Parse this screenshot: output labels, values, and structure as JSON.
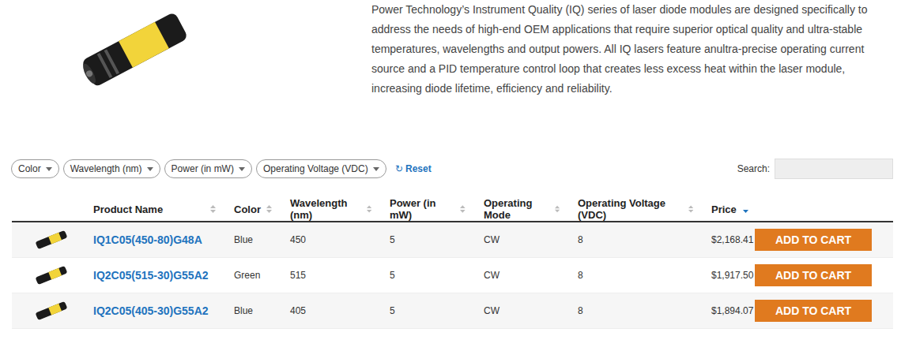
{
  "intro": {
    "description": "Power Technology’s Instrument Quality (IQ) series of laser diode modules are designed specifically to address the needs of high-end OEM applications that require superior optical quality and ultra-stable temperatures, wavelengths and output powers. All IQ lasers feature anultra-precise operating current source and a PID temperature control loop that creates less excess heat within the laser module, increasing diode lifetime, efficiency and reliability."
  },
  "filters": [
    {
      "label": "Color"
    },
    {
      "label": "Wavelength (nm)"
    },
    {
      "label": "Power (in mW)"
    },
    {
      "label": "Operating Voltage (VDC)"
    }
  ],
  "reset": {
    "icon": "↻",
    "label": "Reset"
  },
  "search": {
    "label": "Search:",
    "value": ""
  },
  "table": {
    "columns": [
      {
        "label": "Product Name",
        "sorted": false
      },
      {
        "label": "Color",
        "sorted": false
      },
      {
        "label": "Wavelength (nm)",
        "sorted": false
      },
      {
        "label": "Power (in mW)",
        "sorted": false
      },
      {
        "label": "Operating Mode",
        "sorted": false
      },
      {
        "label": "Operating Voltage (VDC)",
        "sorted": false
      },
      {
        "label": "Price",
        "sorted": true
      }
    ],
    "rows": [
      {
        "name": "IQ1C05(450-80)G48A",
        "color": "Blue",
        "wavelength": "450",
        "power": "5",
        "mode": "CW",
        "voltage": "8",
        "price": "$2,168.41",
        "button": "ADD TO CART"
      },
      {
        "name": "IQ2C05(515-30)G55A2",
        "color": "Green",
        "wavelength": "515",
        "power": "5",
        "mode": "CW",
        "voltage": "8",
        "price": "$1,917.50",
        "button": "ADD TO CART"
      },
      {
        "name": "IQ2C05(405-30)G55A2",
        "color": "Blue",
        "wavelength": "405",
        "power": "5",
        "mode": "CW",
        "voltage": "8",
        "price": "$1,894.07",
        "button": "ADD TO CART"
      }
    ]
  }
}
